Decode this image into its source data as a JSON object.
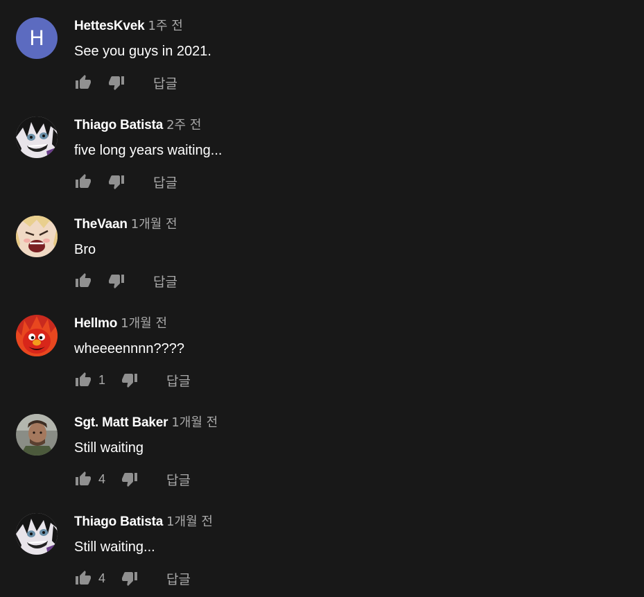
{
  "comments": [
    {
      "author": "HettesKvek",
      "time": "1주 전",
      "text": "See you guys in 2021.",
      "likes": "",
      "reply_label": "답글",
      "avatar": {
        "type": "letter",
        "letter": "H",
        "color": "#5c6bc0"
      }
    },
    {
      "author": "Thiago Batista",
      "time": "2주 전",
      "text": "five long years waiting...",
      "likes": "",
      "reply_label": "답글",
      "avatar": {
        "type": "image",
        "icon": "anime-character-avatar"
      }
    },
    {
      "author": "TheVaan",
      "time": "1개월 전",
      "text": "Bro",
      "likes": "",
      "reply_label": "답글",
      "avatar": {
        "type": "image",
        "icon": "anime-face-avatar"
      }
    },
    {
      "author": "Hellmo",
      "time": "1개월 전",
      "text": "wheeeennnn????",
      "likes": "1",
      "reply_label": "답글",
      "avatar": {
        "type": "image",
        "icon": "red-puppet-fire-avatar"
      }
    },
    {
      "author": "Sgt. Matt Baker",
      "time": "1개월 전",
      "text": "Still waiting",
      "likes": "4",
      "reply_label": "답글",
      "avatar": {
        "type": "image",
        "icon": "soldier-portrait-avatar"
      }
    },
    {
      "author": "Thiago Batista",
      "time": "1개월 전",
      "text": "Still waiting...",
      "likes": "4",
      "reply_label": "답글",
      "avatar": {
        "type": "image",
        "icon": "anime-character-avatar"
      }
    }
  ],
  "colors": {
    "background": "#181818",
    "author": "#ffffff",
    "meta": "#aaaaaa",
    "icon": "#909090"
  }
}
